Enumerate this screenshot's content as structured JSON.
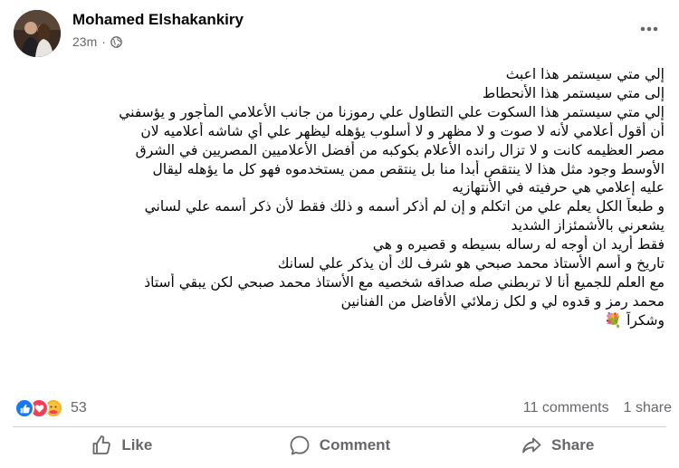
{
  "post": {
    "author": "Mohamed Elshakankiry",
    "time": "23m",
    "separator": "·",
    "audience_icon": "globe-icon",
    "lines": [
      "إلي متي سيستمر هذا اعبث",
      "إلى متي سيستمر هذا الأنحطاط",
      "إلي متي سيستمر هذا السكوت علي التطاول علي رموزنا من جانب الأعلامي المأجور و يؤسفني",
      "أن أقول أعلامي لأنه لا صوت و لا مظهر و لا أسلوب يؤهله ليظهر علي أي شاشه أعلاميه لان",
      "مصر العظيمه كانت و لا تزال رانده الأعلام بكوكبه من أفضل الأعلاميين المصريين في الشرق",
      "الأوسط وجود مثل هذا لا ينتقص أبدا منا بل ينتقص ممن يستخدموه  فهو كل ما يؤهله ليقال",
      "عليه إعلامي  هي حرفيته في الأنتهازيه",
      "و طبعاً الكل يعلم علي من اتكلم و إن لم أذكر أسمه و ذلك فقط لأن ذكر أسمه علي لساني",
      "يشعرني بالأشمئزاز الشديد",
      "فقط أريد ان  أوجه له رساله بسيطه و قصيره و هي",
      "تاريخ و أسم الأستاذ محمد صبحي هو شرف لك أن يذكر علي لسانك",
      "مع العلم للجميع أنا لا تربطني صله صداقه شخصيه مع الأستاذ محمد صبحي لكن يبقي أستاذ",
      "محمد رمز و قدوه لي و لكل زملائي الأفاضل من الفنانين",
      "وشكراً 💐"
    ]
  },
  "stats": {
    "reaction_count": "53",
    "reaction_icons": [
      "like-icon",
      "love-icon",
      "care-icon"
    ],
    "comments": "11 comments",
    "shares": "1 share"
  },
  "actions": {
    "like": "Like",
    "comment": "Comment",
    "share": "Share"
  },
  "colors": {
    "like_blue": "#1877f2",
    "love_red": "#f33e58",
    "care_yellow": "#f7b125",
    "secondary_text": "#65676b",
    "divider": "#ced0d4"
  }
}
